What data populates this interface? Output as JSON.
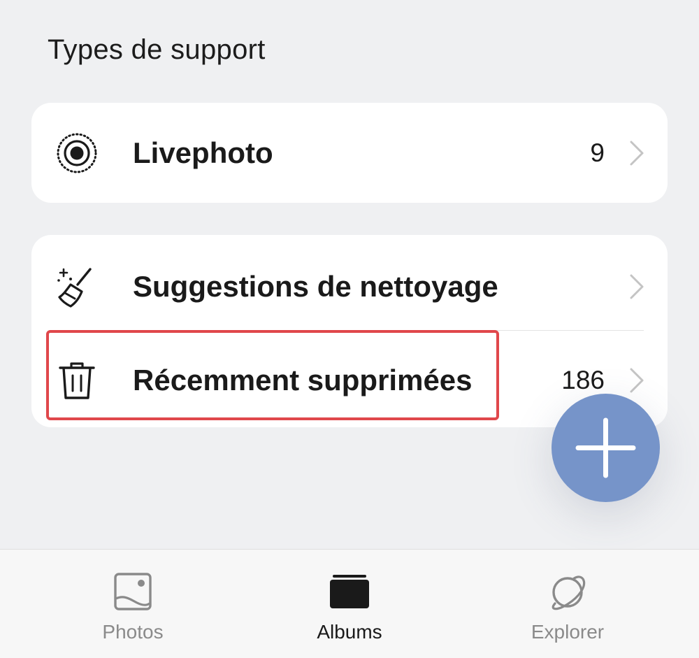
{
  "section": {
    "title": "Types de support"
  },
  "media_types": [
    {
      "label": "Livephoto",
      "count": "9",
      "icon": "livephoto-icon"
    }
  ],
  "utilities": [
    {
      "label": "Suggestions de nettoyage",
      "count": "",
      "icon": "broom-icon"
    },
    {
      "label": "Récemment supprimées",
      "count": "186",
      "icon": "trash-icon"
    }
  ],
  "fab": {
    "icon": "plus-icon",
    "color": "#7694c9"
  },
  "highlight": {
    "color": "#e0474b"
  },
  "tabbar": {
    "tabs": [
      {
        "label": "Photos",
        "icon": "photo-icon",
        "active": false
      },
      {
        "label": "Albums",
        "icon": "albums-icon",
        "active": true
      },
      {
        "label": "Explorer",
        "icon": "planet-icon",
        "active": false
      }
    ]
  }
}
